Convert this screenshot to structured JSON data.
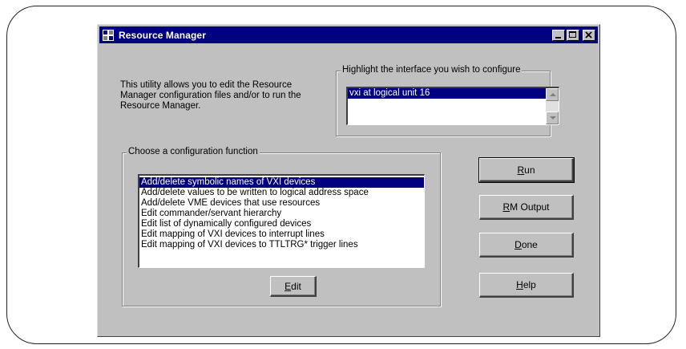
{
  "window": {
    "title": "Resource Manager",
    "icon": "resource-manager-icon",
    "controls": [
      "minimize",
      "maximize",
      "close"
    ]
  },
  "description": "This utility allows you to edit the Resource Manager configuration files and/or to run the Resource Manager.",
  "interface_group": {
    "legend": "Highlight the interface you wish to configure",
    "items": [
      "vxi at logical unit 16"
    ],
    "selected_index": 0
  },
  "function_group": {
    "legend": "Choose a configuration function",
    "items": [
      "Add/delete symbolic names of VXI devices",
      "Add/delete values to be written to logical address space",
      "Add/delete VME devices that use resources",
      "Edit commander/servant hierarchy",
      "Edit list of dynamically configured devices",
      "Edit mapping of VXI devices to interrupt lines",
      "Edit mapping of VXI devices to TTLTRG* trigger lines"
    ],
    "selected_index": 0,
    "edit_button": {
      "mnemonic": "E",
      "rest": "dit"
    }
  },
  "buttons": {
    "run": {
      "mnemonic": "R",
      "rest": "un"
    },
    "rm_output": {
      "mnemonic": "R",
      "rest": "M Output"
    },
    "done": {
      "mnemonic": "D",
      "rest": "one"
    },
    "help": {
      "mnemonic": "H",
      "rest": "elp"
    }
  },
  "colors": {
    "title_bar": "#000080",
    "selection": "#000080",
    "face": "#c0c0c0"
  }
}
